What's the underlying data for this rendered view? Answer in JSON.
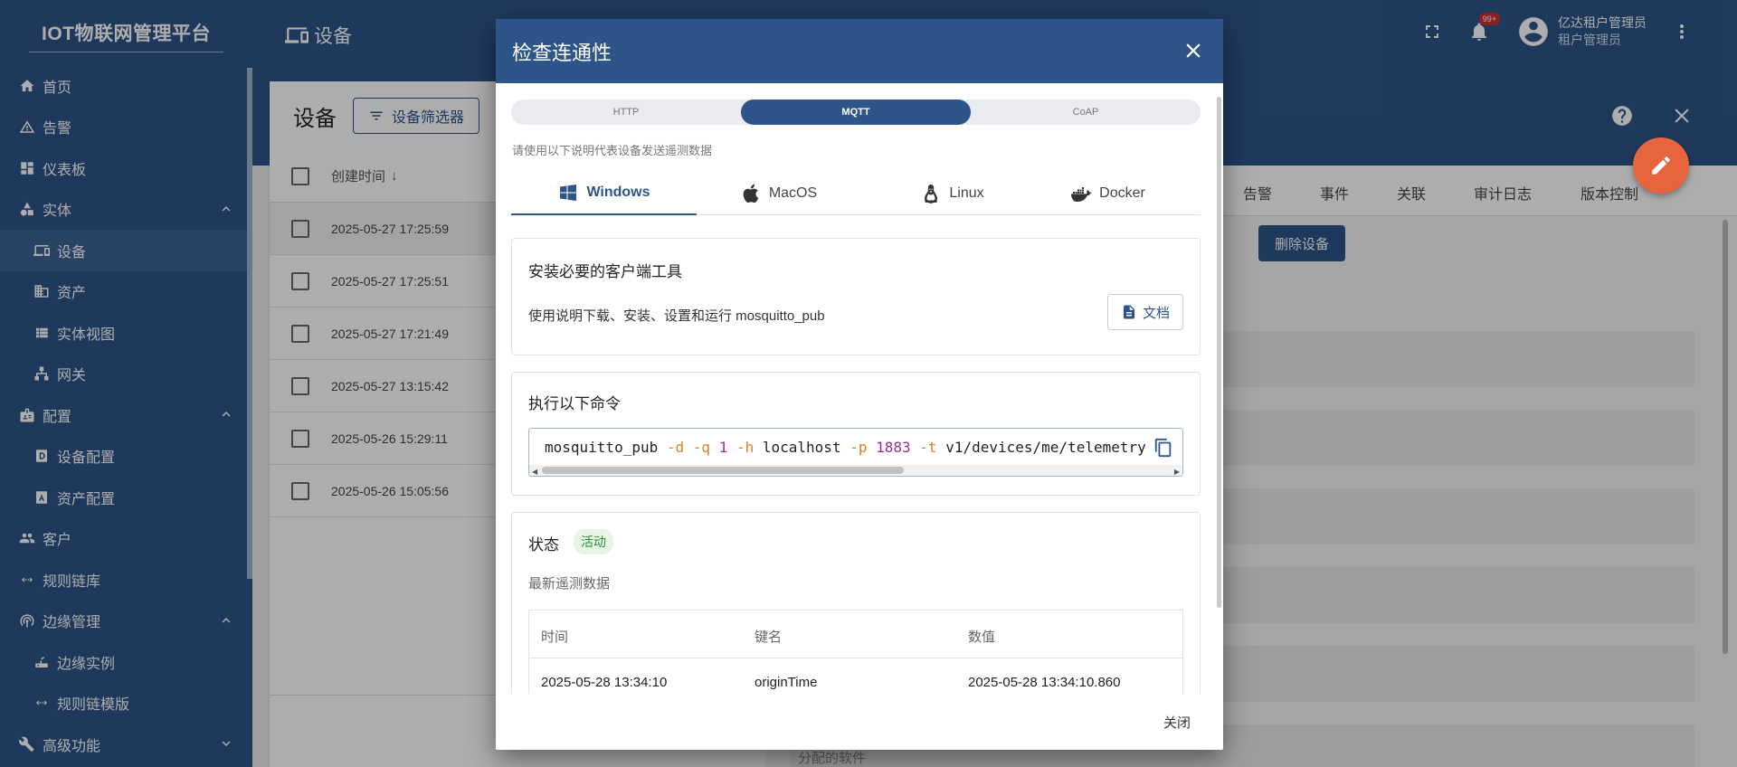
{
  "app": {
    "brand": "IOT物联网管理平台"
  },
  "sidebar": {
    "items": [
      {
        "label": "首页",
        "icon": "home-icon"
      },
      {
        "label": "告警",
        "icon": "warning-icon"
      },
      {
        "label": "仪表板",
        "icon": "dashboard-icon"
      },
      {
        "label": "实体",
        "icon": "entity-icon",
        "expanded": true
      },
      {
        "label": "设备",
        "icon": "device-icon",
        "active": true
      },
      {
        "label": "资产",
        "icon": "asset-icon"
      },
      {
        "label": "实体视图",
        "icon": "entity-view-icon"
      },
      {
        "label": "网关",
        "icon": "gateway-icon"
      },
      {
        "label": "配置",
        "icon": "config-icon",
        "expanded": true
      },
      {
        "label": "设备配置",
        "icon": "device-profile-icon"
      },
      {
        "label": "资产配置",
        "icon": "asset-profile-icon"
      },
      {
        "label": "客户",
        "icon": "customers-icon"
      },
      {
        "label": "规则链库",
        "icon": "rule-chain-icon"
      },
      {
        "label": "边缘管理",
        "icon": "edge-icon",
        "expanded": true
      },
      {
        "label": "边缘实例",
        "icon": "edge-instance-icon"
      },
      {
        "label": "规则链模版",
        "icon": "rule-template-icon"
      },
      {
        "label": "高级功能",
        "icon": "advanced-icon",
        "expanded": false
      }
    ]
  },
  "topbar": {
    "title": "设备",
    "notification_count": "99+",
    "user_name": "亿达租户管理员",
    "user_role": "租户管理员"
  },
  "devices_panel": {
    "title": "设备",
    "filter_label": "设备筛选器",
    "column_created": "创建时间",
    "rows": [
      "2025-05-27 17:25:59",
      "2025-05-27 17:25:51",
      "2025-05-27 17:21:49",
      "2025-05-27 13:15:42",
      "2025-05-26 15:29:11",
      "2025-05-26 15:05:56"
    ]
  },
  "detail_panel": {
    "tabs": [
      "告警",
      "事件",
      "关联",
      "审计日志",
      "版本控制"
    ],
    "delete_button": "删除设备",
    "partial_text": "分配的软件"
  },
  "dialog": {
    "title": "检查连通性",
    "protocols": [
      "HTTP",
      "MQTT",
      "CoAP"
    ],
    "active_protocol": "MQTT",
    "hint": "请使用以下说明代表设备发送遥测数据",
    "os_tabs": [
      {
        "label": "Windows",
        "icon": "windows-icon"
      },
      {
        "label": "MacOS",
        "icon": "apple-icon"
      },
      {
        "label": "Linux",
        "icon": "linux-icon"
      },
      {
        "label": "Docker",
        "icon": "docker-icon"
      }
    ],
    "active_os": "Windows",
    "install": {
      "title": "安装必要的客户端工具",
      "desc": "使用说明下载、安装、设置和运行 mosquitto_pub",
      "doc_button": "文档"
    },
    "execute": {
      "title": "执行以下命令",
      "command": {
        "cmd": "mosquitto_pub",
        "d": "-d",
        "q": "-q",
        "qv": "1",
        "h": "-h",
        "host": "localhost",
        "p": "-p",
        "port": "1883",
        "t": "-t",
        "topic": "v1/devices/me/telemetry"
      }
    },
    "status": {
      "label": "状态",
      "badge": "活动",
      "latest_label": "最新遥测数据",
      "columns": [
        "时间",
        "键名",
        "数值"
      ],
      "rows": [
        {
          "time": "2025-05-28 13:34:10",
          "key": "originTime",
          "value": "2025-05-28 13:34:10.860"
        }
      ]
    },
    "close_button": "关闭"
  },
  "colors": {
    "primary": "#2e5589",
    "accent_fab": "#e8643d",
    "status_green": "#2e8b3a",
    "code_flag": "#d4822a",
    "code_number": "#9c2c8d"
  }
}
